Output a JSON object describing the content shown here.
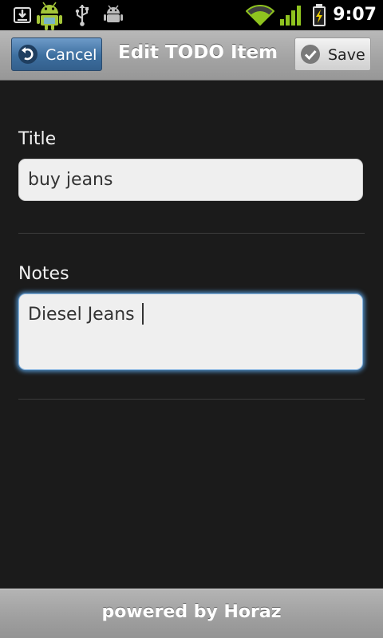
{
  "status_bar": {
    "time": "9:07",
    "icons": [
      "download-icon",
      "android-icon",
      "usb-icon",
      "debug-icon",
      "wifi-icon",
      "signal-icon",
      "battery-charging-icon"
    ]
  },
  "action_bar": {
    "cancel_label": "Cancel",
    "title": "Edit TODO Item",
    "save_label": "Save"
  },
  "form": {
    "title_label": "Title",
    "title_value": "buy jeans",
    "notes_label": "Notes",
    "notes_value": "Diesel Jeans"
  },
  "footer": {
    "text": "powered by Horaz"
  },
  "colors": {
    "background": "#1b1b1b",
    "action_bar": "#a4a4a4",
    "cancel_button": "#3d6f9f",
    "focus_glow": "#4f8fc9",
    "signal_green": "#8fc31f"
  }
}
